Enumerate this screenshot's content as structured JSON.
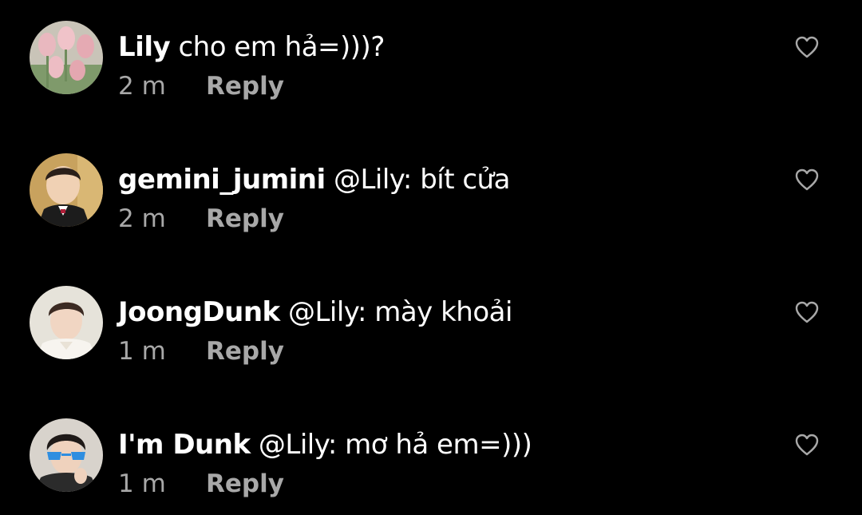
{
  "theme": {
    "background": "#000000",
    "text": "#ffffff",
    "muted": "#a8a8a8"
  },
  "comments": [
    {
      "username": "Lily",
      "text": "cho em hả=)))?",
      "time": "2 m",
      "reply_label": "Reply",
      "like_icon": "heart-outline-icon"
    },
    {
      "username": "gemini_jumini",
      "text": "@Lily: bít cửa",
      "time": "2 m",
      "reply_label": "Reply",
      "like_icon": "heart-outline-icon"
    },
    {
      "username": "JoongDunk",
      "text": "@Lily: mày khoải",
      "time": "1 m",
      "reply_label": "Reply",
      "like_icon": "heart-outline-icon"
    },
    {
      "username": "I'm Dunk",
      "text": "@Lily: mơ hả em=)))",
      "time": "1 m",
      "reply_label": "Reply",
      "like_icon": "heart-outline-icon"
    }
  ]
}
